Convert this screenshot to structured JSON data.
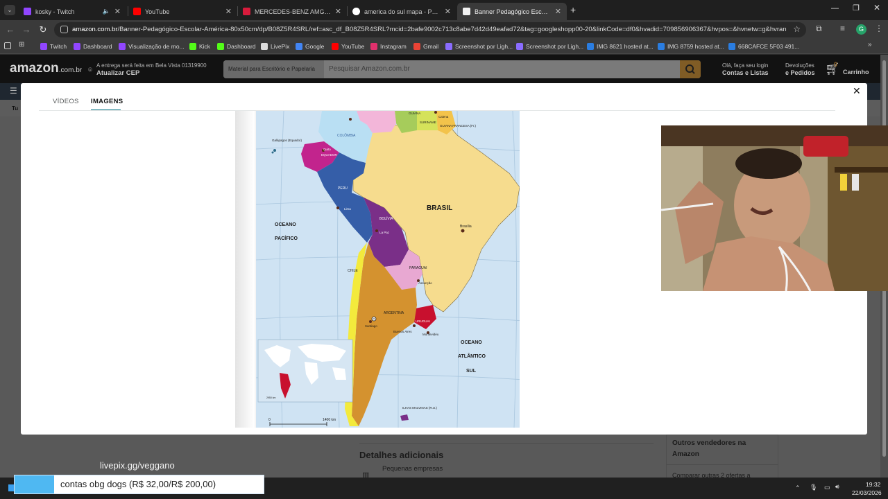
{
  "browser": {
    "tabs": [
      {
        "title": "kosky - Twitch",
        "color": "#9146ff",
        "active": false,
        "muted_icon": true
      },
      {
        "title": "YouTube",
        "color": "#ff0000",
        "active": false
      },
      {
        "title": "MERCEDES-BENZ AMG GT 63 4",
        "color": "#d81b3c",
        "active": false
      },
      {
        "title": "america do sul mapa - Pesquisa",
        "color": "#ffffff",
        "active": false
      },
      {
        "title": "Banner Pedagógico Escolar Ma",
        "color": "#222222",
        "active": true
      }
    ],
    "url_host": "amazon.com.br",
    "url_path": "/Banner-Pedagógico-Escolar-América-80x50cm/dp/B08Z5R4SRL/ref=asc_df_B08Z5R4SRL?mcid=2bafe9002c713c8abe7d42d49eafad72&tag=googleshopp00-20&linkCode=df0&hvadid=709856906367&hvpos=&hvnetw=g&hvrand=7...",
    "profile_initial": "G",
    "bookmarks": [
      {
        "label": "Twitch",
        "color": "#9146ff"
      },
      {
        "label": "Dashboard",
        "color": "#9146ff"
      },
      {
        "label": "Visualização de mo...",
        "color": "#9146ff"
      },
      {
        "label": "Kick",
        "color": "#53fc18"
      },
      {
        "label": "Dashboard",
        "color": "#53fc18"
      },
      {
        "label": "LivePix",
        "color": "#dddddd"
      },
      {
        "label": "Google",
        "color": "#4285f4"
      },
      {
        "label": "YouTube",
        "color": "#ff0000"
      },
      {
        "label": "Instagram",
        "color": "#e1306c"
      },
      {
        "label": "Gmail",
        "color": "#ea4335"
      },
      {
        "label": "Screenshot por Ligh...",
        "color": "#8a6cff"
      },
      {
        "label": "Screenshot por Ligh...",
        "color": "#8a6cff"
      },
      {
        "label": "IMG 8621 hosted at...",
        "color": "#2a7de1"
      },
      {
        "label": "IMG 8759 hosted at...",
        "color": "#2a7de1"
      },
      {
        "label": "668CAFCE 5F03 491...",
        "color": "#2a7de1"
      }
    ]
  },
  "amazon": {
    "logo": "amazon",
    "logo_suffix": ".com.br",
    "delivery_line1": "A entrega será feita em Bela Vista 01319900",
    "delivery_line2": "Atualizar CEP",
    "search_category": "Material para Escritório e Papelaria",
    "search_placeholder": "Pesquisar Amazon.com.br",
    "account_line1": "Olá, faça seu login",
    "account_line2": "Contas e Listas",
    "returns_line1": "Devoluções",
    "returns_line2": "e Pedidos",
    "cart_count": "0",
    "cart_label": "Carrinho",
    "sub_nav_fragment": "Tu",
    "additional_details": "Detalhes adicionais",
    "small_business": "Pequenas empresas",
    "other_sellers": "Outros vendedores na Amazon",
    "compare_offers": "Comparar outras 2 ofertas a"
  },
  "modal": {
    "tab_videos": "VÍDEOS",
    "tab_images": "IMAGENS",
    "active_tab": "IMAGENS"
  },
  "map": {
    "countries": {
      "colombia": "COLÔMBIA",
      "guiana": "GUIANA",
      "suriname": "SURINAME",
      "guiana_francesa": "GUIANA FRANCESA (Fr.)",
      "equador": "EQUADOR",
      "peru": "PERU",
      "brasil": "BRASIL",
      "bolivia": "BOLÍVIA",
      "paraguai": "PARAGUAI",
      "chile": "CHILE",
      "argentina": "ARGENTINA",
      "uruguai": "URUGUAI"
    },
    "cities": {
      "caiena": "Caiena",
      "quito": "Quito",
      "lima": "Lima",
      "la_paz": "La Paz",
      "brasilia": "Brasília",
      "assuncao": "Assunção",
      "santiago": "Santiago",
      "buenos_aires": "Buenos Aires",
      "montevideu": "Montevidéu"
    },
    "places": {
      "galapagos": "Galápagos (Equador)",
      "oceano_pacifico_1": "OCEANO",
      "oceano_pacifico_2": "PACÍFICO",
      "oceano_atlantico_1": "OCEANO",
      "oceano_atlantico_2": "ATLÂNTICO",
      "oceano_atlantico_3": "SUL",
      "malvinas": "ILHAS MALVINAS (R.U.)",
      "scale_zero": "0",
      "scale_km": "1400 km",
      "inset_scale": "2950 km"
    }
  },
  "stream_overlay": {
    "livepix_link": "livepix.gg/veggano",
    "donation_text": "contas obg dogs (R$ 32,00/R$ 200,00)"
  },
  "taskbar": {
    "time": "19:32",
    "date": "22/03/2026"
  }
}
